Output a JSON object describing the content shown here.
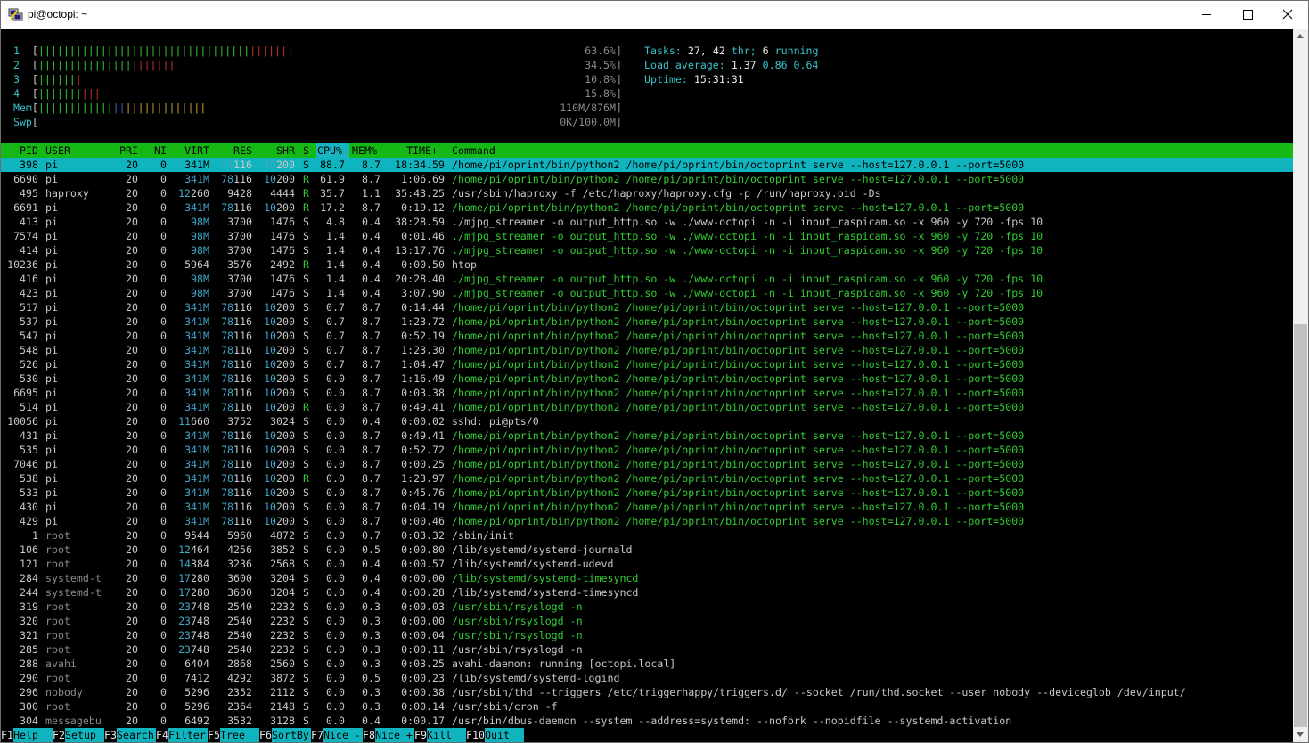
{
  "window": {
    "title": "pi@octopi: ~"
  },
  "meters": {
    "cpus": [
      {
        "label": "1",
        "value": "63.6%]"
      },
      {
        "label": "2",
        "value": "34.5%]"
      },
      {
        "label": "3",
        "value": "10.8%]"
      },
      {
        "label": "4",
        "value": "15.8%]"
      }
    ],
    "mem": {
      "label": "Mem",
      "value": "110M/876M]"
    },
    "swp": {
      "label": "Swp",
      "value": "0K/100.0M]"
    },
    "cpu_levels": [
      0.636,
      0.345,
      0.108,
      0.158
    ],
    "mem_level": 0.126
  },
  "summary": {
    "tasks_label": "Tasks:",
    "tasks_value": "27,",
    "thr_value": "42",
    "thr_label": "thr;",
    "running_value": "6",
    "running_label": "running",
    "load_label": "Load average:",
    "load1": "1.37",
    "load5": "0.86",
    "load15": "0.64",
    "uptime_label": "Uptime:",
    "uptime_value": "15:31:31"
  },
  "columns": {
    "pid": "PID",
    "user": "USER",
    "pri": "PRI",
    "ni": "NI",
    "virt": "VIRT",
    "res": "RES",
    "shr": "SHR",
    "s": "S",
    "cpu": "CPU%",
    "mem": "MEM%",
    "time": "TIME+",
    "command": "Command"
  },
  "processes": [
    {
      "pid": "398",
      "user": "pi",
      "pri": "20",
      "ni": "0",
      "virt": "341M",
      "res": "78116",
      "shr": "10200",
      "s": "S",
      "cpu": "88.7",
      "mem": "8.7",
      "time": "18:34.59",
      "cmd": "/home/pi/oprint/bin/python2 /home/pi/oprint/bin/octoprint serve --host=127.0.0.1 --port=5000"
    },
    {
      "pid": "6690",
      "user": "pi",
      "pri": "20",
      "ni": "0",
      "virt": "341M",
      "res": "78116",
      "shr": "10200",
      "s": "R",
      "cpu": "61.9",
      "mem": "8.7",
      "time": "1:06.69",
      "cmd": "/home/pi/oprint/bin/python2 /home/pi/oprint/bin/octoprint serve --host=127.0.0.1 --port=5000"
    },
    {
      "pid": "495",
      "user": "haproxy",
      "pri": "20",
      "ni": "0",
      "virt": "12260",
      "res": "9428",
      "shr": "4444",
      "s": "R",
      "cpu": "35.7",
      "mem": "1.1",
      "time": "35:43.25",
      "cmd": "/usr/sbin/haproxy -f /etc/haproxy/haproxy.cfg -p /run/haproxy.pid -Ds"
    },
    {
      "pid": "6691",
      "user": "pi",
      "pri": "20",
      "ni": "0",
      "virt": "341M",
      "res": "78116",
      "shr": "10200",
      "s": "R",
      "cpu": "17.2",
      "mem": "8.7",
      "time": "0:19.12",
      "cmd": "/home/pi/oprint/bin/python2 /home/pi/oprint/bin/octoprint serve --host=127.0.0.1 --port=5000"
    },
    {
      "pid": "413",
      "user": "pi",
      "pri": "20",
      "ni": "0",
      "virt": "98M",
      "res": "3700",
      "shr": "1476",
      "s": "S",
      "cpu": "4.8",
      "mem": "0.4",
      "time": "38:28.59",
      "cmd": "./mjpg_streamer -o output_http.so -w ./www-octopi -n -i input_raspicam.so -x 960 -y 720 -fps 10"
    },
    {
      "pid": "7574",
      "user": "pi",
      "pri": "20",
      "ni": "0",
      "virt": "98M",
      "res": "3700",
      "shr": "1476",
      "s": "S",
      "cpu": "1.4",
      "mem": "0.4",
      "time": "0:01.46",
      "cmd": "./mjpg_streamer -o output_http.so -w ./www-octopi -n -i input_raspicam.so -x 960 -y 720 -fps 10"
    },
    {
      "pid": "414",
      "user": "pi",
      "pri": "20",
      "ni": "0",
      "virt": "98M",
      "res": "3700",
      "shr": "1476",
      "s": "S",
      "cpu": "1.4",
      "mem": "0.4",
      "time": "13:17.76",
      "cmd": "./mjpg_streamer -o output_http.so -w ./www-octopi -n -i input_raspicam.so -x 960 -y 720 -fps 10"
    },
    {
      "pid": "10236",
      "user": "pi",
      "pri": "20",
      "ni": "0",
      "virt": "5964",
      "res": "3576",
      "shr": "2492",
      "s": "R",
      "cpu": "1.4",
      "mem": "0.4",
      "time": "0:00.50",
      "cmd": "htop"
    },
    {
      "pid": "416",
      "user": "pi",
      "pri": "20",
      "ni": "0",
      "virt": "98M",
      "res": "3700",
      "shr": "1476",
      "s": "S",
      "cpu": "1.4",
      "mem": "0.4",
      "time": "20:28.40",
      "cmd": "./mjpg_streamer -o output_http.so -w ./www-octopi -n -i input_raspicam.so -x 960 -y 720 -fps 10"
    },
    {
      "pid": "423",
      "user": "pi",
      "pri": "20",
      "ni": "0",
      "virt": "98M",
      "res": "3700",
      "shr": "1476",
      "s": "S",
      "cpu": "1.4",
      "mem": "0.4",
      "time": "3:07.90",
      "cmd": "./mjpg_streamer -o output_http.so -w ./www-octopi -n -i input_raspicam.so -x 960 -y 720 -fps 10"
    },
    {
      "pid": "517",
      "user": "pi",
      "pri": "20",
      "ni": "0",
      "virt": "341M",
      "res": "78116",
      "shr": "10200",
      "s": "S",
      "cpu": "0.7",
      "mem": "8.7",
      "time": "0:14.44",
      "cmd": "/home/pi/oprint/bin/python2 /home/pi/oprint/bin/octoprint serve --host=127.0.0.1 --port=5000"
    },
    {
      "pid": "537",
      "user": "pi",
      "pri": "20",
      "ni": "0",
      "virt": "341M",
      "res": "78116",
      "shr": "10200",
      "s": "S",
      "cpu": "0.7",
      "mem": "8.7",
      "time": "1:23.72",
      "cmd": "/home/pi/oprint/bin/python2 /home/pi/oprint/bin/octoprint serve --host=127.0.0.1 --port=5000"
    },
    {
      "pid": "547",
      "user": "pi",
      "pri": "20",
      "ni": "0",
      "virt": "341M",
      "res": "78116",
      "shr": "10200",
      "s": "S",
      "cpu": "0.7",
      "mem": "8.7",
      "time": "0:52.19",
      "cmd": "/home/pi/oprint/bin/python2 /home/pi/oprint/bin/octoprint serve --host=127.0.0.1 --port=5000"
    },
    {
      "pid": "548",
      "user": "pi",
      "pri": "20",
      "ni": "0",
      "virt": "341M",
      "res": "78116",
      "shr": "10200",
      "s": "S",
      "cpu": "0.7",
      "mem": "8.7",
      "time": "1:23.30",
      "cmd": "/home/pi/oprint/bin/python2 /home/pi/oprint/bin/octoprint serve --host=127.0.0.1 --port=5000"
    },
    {
      "pid": "526",
      "user": "pi",
      "pri": "20",
      "ni": "0",
      "virt": "341M",
      "res": "78116",
      "shr": "10200",
      "s": "S",
      "cpu": "0.7",
      "mem": "8.7",
      "time": "1:04.47",
      "cmd": "/home/pi/oprint/bin/python2 /home/pi/oprint/bin/octoprint serve --host=127.0.0.1 --port=5000"
    },
    {
      "pid": "530",
      "user": "pi",
      "pri": "20",
      "ni": "0",
      "virt": "341M",
      "res": "78116",
      "shr": "10200",
      "s": "S",
      "cpu": "0.0",
      "mem": "8.7",
      "time": "1:16.49",
      "cmd": "/home/pi/oprint/bin/python2 /home/pi/oprint/bin/octoprint serve --host=127.0.0.1 --port=5000"
    },
    {
      "pid": "6695",
      "user": "pi",
      "pri": "20",
      "ni": "0",
      "virt": "341M",
      "res": "78116",
      "shr": "10200",
      "s": "S",
      "cpu": "0.0",
      "mem": "8.7",
      "time": "0:03.38",
      "cmd": "/home/pi/oprint/bin/python2 /home/pi/oprint/bin/octoprint serve --host=127.0.0.1 --port=5000"
    },
    {
      "pid": "514",
      "user": "pi",
      "pri": "20",
      "ni": "0",
      "virt": "341M",
      "res": "78116",
      "shr": "10200",
      "s": "R",
      "cpu": "0.0",
      "mem": "8.7",
      "time": "0:49.41",
      "cmd": "/home/pi/oprint/bin/python2 /home/pi/oprint/bin/octoprint serve --host=127.0.0.1 --port=5000"
    },
    {
      "pid": "10056",
      "user": "pi",
      "pri": "20",
      "ni": "0",
      "virt": "11660",
      "res": "3752",
      "shr": "3024",
      "s": "S",
      "cpu": "0.0",
      "mem": "0.4",
      "time": "0:00.02",
      "cmd": "sshd: pi@pts/0"
    },
    {
      "pid": "431",
      "user": "pi",
      "pri": "20",
      "ni": "0",
      "virt": "341M",
      "res": "78116",
      "shr": "10200",
      "s": "S",
      "cpu": "0.0",
      "mem": "8.7",
      "time": "0:49.41",
      "cmd": "/home/pi/oprint/bin/python2 /home/pi/oprint/bin/octoprint serve --host=127.0.0.1 --port=5000"
    },
    {
      "pid": "535",
      "user": "pi",
      "pri": "20",
      "ni": "0",
      "virt": "341M",
      "res": "78116",
      "shr": "10200",
      "s": "S",
      "cpu": "0.0",
      "mem": "8.7",
      "time": "0:52.72",
      "cmd": "/home/pi/oprint/bin/python2 /home/pi/oprint/bin/octoprint serve --host=127.0.0.1 --port=5000"
    },
    {
      "pid": "7046",
      "user": "pi",
      "pri": "20",
      "ni": "0",
      "virt": "341M",
      "res": "78116",
      "shr": "10200",
      "s": "S",
      "cpu": "0.0",
      "mem": "8.7",
      "time": "0:00.25",
      "cmd": "/home/pi/oprint/bin/python2 /home/pi/oprint/bin/octoprint serve --host=127.0.0.1 --port=5000"
    },
    {
      "pid": "538",
      "user": "pi",
      "pri": "20",
      "ni": "0",
      "virt": "341M",
      "res": "78116",
      "shr": "10200",
      "s": "R",
      "cpu": "0.0",
      "mem": "8.7",
      "time": "1:23.97",
      "cmd": "/home/pi/oprint/bin/python2 /home/pi/oprint/bin/octoprint serve --host=127.0.0.1 --port=5000"
    },
    {
      "pid": "533",
      "user": "pi",
      "pri": "20",
      "ni": "0",
      "virt": "341M",
      "res": "78116",
      "shr": "10200",
      "s": "S",
      "cpu": "0.0",
      "mem": "8.7",
      "time": "0:45.76",
      "cmd": "/home/pi/oprint/bin/python2 /home/pi/oprint/bin/octoprint serve --host=127.0.0.1 --port=5000"
    },
    {
      "pid": "430",
      "user": "pi",
      "pri": "20",
      "ni": "0",
      "virt": "341M",
      "res": "78116",
      "shr": "10200",
      "s": "S",
      "cpu": "0.0",
      "mem": "8.7",
      "time": "0:04.19",
      "cmd": "/home/pi/oprint/bin/python2 /home/pi/oprint/bin/octoprint serve --host=127.0.0.1 --port=5000"
    },
    {
      "pid": "429",
      "user": "pi",
      "pri": "20",
      "ni": "0",
      "virt": "341M",
      "res": "78116",
      "shr": "10200",
      "s": "S",
      "cpu": "0.0",
      "mem": "8.7",
      "time": "0:00.46",
      "cmd": "/home/pi/oprint/bin/python2 /home/pi/oprint/bin/octoprint serve --host=127.0.0.1 --port=5000"
    },
    {
      "pid": "1",
      "user": "root",
      "pri": "20",
      "ni": "0",
      "virt": "9544",
      "res": "5960",
      "shr": "4872",
      "s": "S",
      "cpu": "0.0",
      "mem": "0.7",
      "time": "0:03.32",
      "cmd": "/sbin/init"
    },
    {
      "pid": "106",
      "user": "root",
      "pri": "20",
      "ni": "0",
      "virt": "12464",
      "res": "4256",
      "shr": "3852",
      "s": "S",
      "cpu": "0.0",
      "mem": "0.5",
      "time": "0:00.80",
      "cmd": "/lib/systemd/systemd-journald"
    },
    {
      "pid": "121",
      "user": "root",
      "pri": "20",
      "ni": "0",
      "virt": "14384",
      "res": "3236",
      "shr": "2568",
      "s": "S",
      "cpu": "0.0",
      "mem": "0.4",
      "time": "0:00.57",
      "cmd": "/lib/systemd/systemd-udevd"
    },
    {
      "pid": "284",
      "user": "systemd-t",
      "pri": "20",
      "ni": "0",
      "virt": "17280",
      "res": "3600",
      "shr": "3204",
      "s": "S",
      "cpu": "0.0",
      "mem": "0.4",
      "time": "0:00.00",
      "cmd": "/lib/systemd/systemd-timesyncd"
    },
    {
      "pid": "244",
      "user": "systemd-t",
      "pri": "20",
      "ni": "0",
      "virt": "17280",
      "res": "3600",
      "shr": "3204",
      "s": "S",
      "cpu": "0.0",
      "mem": "0.4",
      "time": "0:00.28",
      "cmd": "/lib/systemd/systemd-timesyncd"
    },
    {
      "pid": "319",
      "user": "root",
      "pri": "20",
      "ni": "0",
      "virt": "23748",
      "res": "2540",
      "shr": "2232",
      "s": "S",
      "cpu": "0.0",
      "mem": "0.3",
      "time": "0:00.03",
      "cmd": "/usr/sbin/rsyslogd -n"
    },
    {
      "pid": "320",
      "user": "root",
      "pri": "20",
      "ni": "0",
      "virt": "23748",
      "res": "2540",
      "shr": "2232",
      "s": "S",
      "cpu": "0.0",
      "mem": "0.3",
      "time": "0:00.00",
      "cmd": "/usr/sbin/rsyslogd -n"
    },
    {
      "pid": "321",
      "user": "root",
      "pri": "20",
      "ni": "0",
      "virt": "23748",
      "res": "2540",
      "shr": "2232",
      "s": "S",
      "cpu": "0.0",
      "mem": "0.3",
      "time": "0:00.04",
      "cmd": "/usr/sbin/rsyslogd -n"
    },
    {
      "pid": "285",
      "user": "root",
      "pri": "20",
      "ni": "0",
      "virt": "23748",
      "res": "2540",
      "shr": "2232",
      "s": "S",
      "cpu": "0.0",
      "mem": "0.3",
      "time": "0:00.11",
      "cmd": "/usr/sbin/rsyslogd -n"
    },
    {
      "pid": "288",
      "user": "avahi",
      "pri": "20",
      "ni": "0",
      "virt": "6404",
      "res": "2868",
      "shr": "2560",
      "s": "S",
      "cpu": "0.0",
      "mem": "0.3",
      "time": "0:03.25",
      "cmd": "avahi-daemon: running [octopi.local]"
    },
    {
      "pid": "290",
      "user": "root",
      "pri": "20",
      "ni": "0",
      "virt": "7412",
      "res": "4292",
      "shr": "3872",
      "s": "S",
      "cpu": "0.0",
      "mem": "0.5",
      "time": "0:00.23",
      "cmd": "/lib/systemd/systemd-logind"
    },
    {
      "pid": "296",
      "user": "nobody",
      "pri": "20",
      "ni": "0",
      "virt": "5296",
      "res": "2352",
      "shr": "2112",
      "s": "S",
      "cpu": "0.0",
      "mem": "0.3",
      "time": "0:00.38",
      "cmd": "/usr/sbin/thd --triggers /etc/triggerhappy/triggers.d/ --socket /run/thd.socket --user nobody --deviceglob /dev/input/"
    },
    {
      "pid": "300",
      "user": "root",
      "pri": "20",
      "ni": "0",
      "virt": "5296",
      "res": "2364",
      "shr": "2148",
      "s": "S",
      "cpu": "0.0",
      "mem": "0.3",
      "time": "0:00.14",
      "cmd": "/usr/sbin/cron -f"
    },
    {
      "pid": "304",
      "user": "messagebu",
      "pri": "20",
      "ni": "0",
      "virt": "6492",
      "res": "3532",
      "shr": "3128",
      "s": "S",
      "cpu": "0.0",
      "mem": "0.4",
      "time": "0:00.17",
      "cmd": "/usr/bin/dbus-daemon --system --address=systemd: --nofork --nopidfile --systemd-activation"
    }
  ],
  "footer": [
    {
      "key": "F1",
      "label": "Help  "
    },
    {
      "key": "F2",
      "label": "Setup "
    },
    {
      "key": "F3",
      "label": "Search"
    },
    {
      "key": "F4",
      "label": "Filter"
    },
    {
      "key": "F5",
      "label": "Tree  "
    },
    {
      "key": "F6",
      "label": "SortBy"
    },
    {
      "key": "F7",
      "label": "Nice -"
    },
    {
      "key": "F8",
      "label": "Nice +"
    },
    {
      "key": "F9",
      "label": "Kill  "
    },
    {
      "key": "F10",
      "label": "Quit  "
    }
  ],
  "colors": {
    "green": "#15b815",
    "cyan": "#10b4be",
    "terminal_bg": "#000000"
  }
}
